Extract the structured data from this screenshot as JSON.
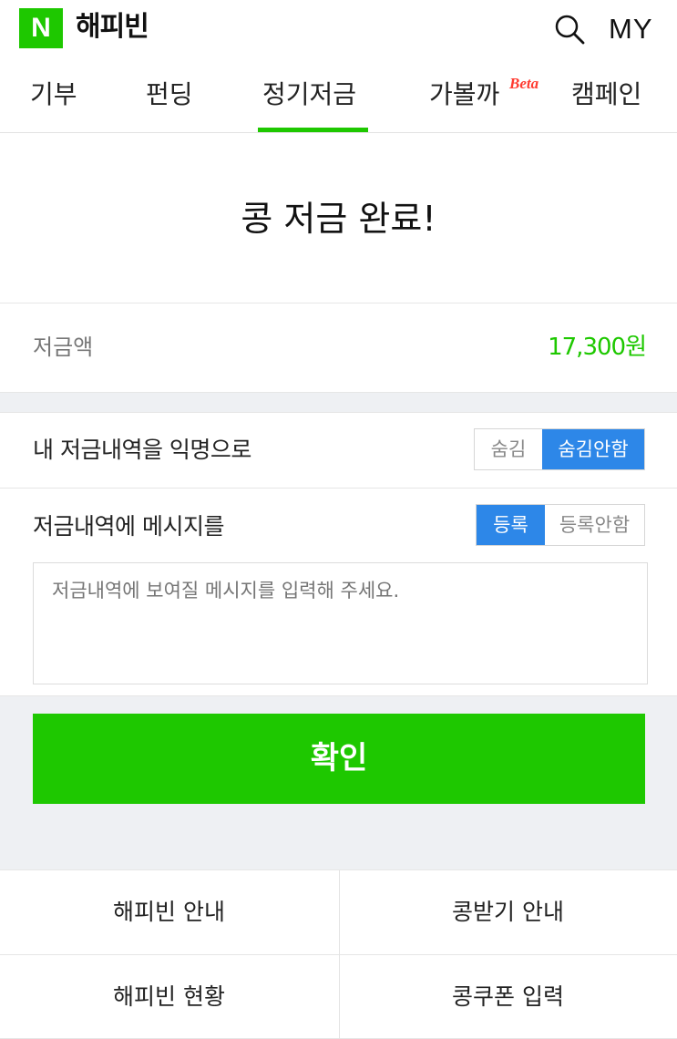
{
  "header": {
    "logo_letter": "N",
    "title": "해피빈",
    "search_icon": "search-icon",
    "my_label": "MY"
  },
  "tabs": [
    {
      "label": "기부",
      "active": false
    },
    {
      "label": "펀딩",
      "active": false
    },
    {
      "label": "정기저금",
      "active": true
    },
    {
      "label": "가볼까",
      "active": false,
      "badge": "Beta"
    },
    {
      "label": "캠페인",
      "active": false
    }
  ],
  "completion": {
    "title": "콩 저금 완료!"
  },
  "amount": {
    "label": "저금액",
    "value": "17,300원"
  },
  "anonymous": {
    "label": "내 저금내역을 익명으로",
    "options": [
      "숨김",
      "숨김안함"
    ],
    "selected": "숨김안함"
  },
  "message": {
    "label": "저금내역에 메시지를",
    "options": [
      "등록",
      "등록안함"
    ],
    "selected": "등록",
    "placeholder": "저금내역에 보여질 메시지를 입력해 주세요."
  },
  "confirm_label": "확인",
  "footer": {
    "links": [
      "해피빈 안내",
      "콩받기 안내",
      "해피빈 현황",
      "콩쿠폰 입력"
    ]
  },
  "colors": {
    "brand_green": "#1ec800",
    "toggle_blue": "#2d87e8",
    "band_gray": "#eef0f3"
  }
}
